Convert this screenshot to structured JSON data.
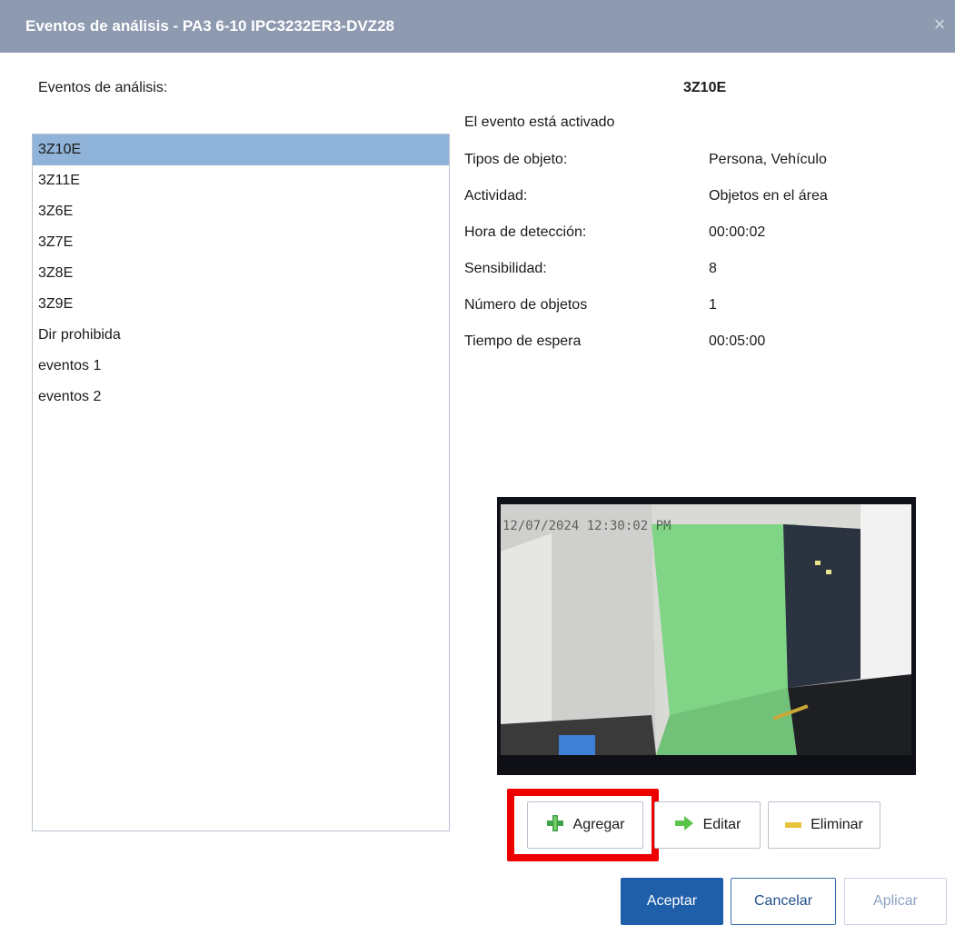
{
  "window": {
    "title": "Eventos de análisis - PA3 6-10 IPC3232ER3-DVZ28",
    "close_glyph": "×"
  },
  "list": {
    "label": "Eventos de análisis:",
    "items": [
      "3Z10E",
      "3Z11E",
      "3Z6E",
      "3Z7E",
      "3Z8E",
      "3Z9E",
      "Dir prohibida",
      "eventos 1",
      "eventos 2"
    ],
    "selected_index": 0
  },
  "detail": {
    "name": "3Z10E",
    "status": "El evento está activado",
    "object_types_label": "Tipos de objeto:",
    "object_types_value": "Persona, Vehículo",
    "activity_label": "Actividad:",
    "activity_value": "Objetos en el área",
    "detection_time_label": "Hora de detección:",
    "detection_time_value": "00:00:02",
    "sensitivity_label": "Sensibilidad:",
    "sensitivity_value": "8",
    "object_count_label": "Número de objetos",
    "object_count_value": "1",
    "wait_time_label": "Tiempo de espera",
    "wait_time_value": "00:05:00"
  },
  "preview": {
    "timestamp": "12/07/2024 12:30:02 PM"
  },
  "actions": {
    "add_label": "Agregar",
    "edit_label": "Editar",
    "delete_label": "Eliminar",
    "add_icon": "plus-icon",
    "edit_icon": "arrow-right-icon",
    "delete_icon": "minus-icon"
  },
  "footer": {
    "accept_label": "Aceptar",
    "cancel_label": "Cancelar",
    "apply_label": "Aplicar"
  },
  "colors": {
    "titlebar": "#8e9aaf",
    "selection": "#8fb3d9",
    "primary": "#1f5ea8",
    "highlight": "#ee0000",
    "zone": "#5fd16a"
  }
}
